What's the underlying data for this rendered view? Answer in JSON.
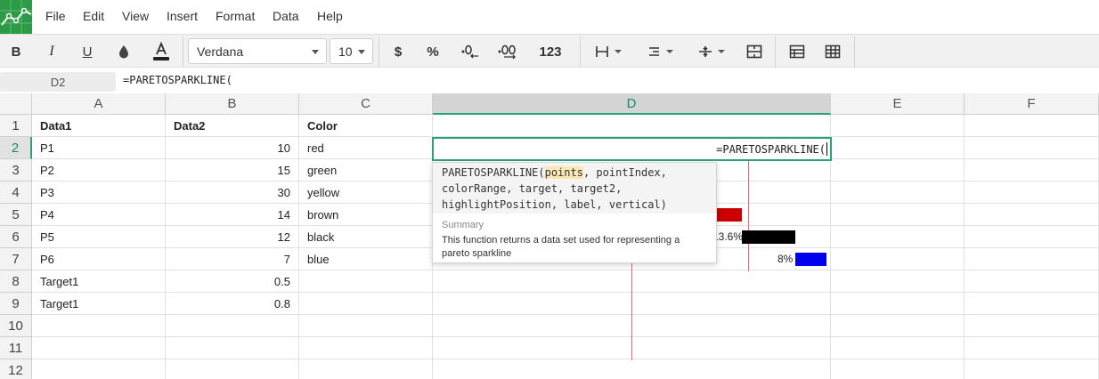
{
  "menu": {
    "items": [
      "File",
      "Edit",
      "View",
      "Insert",
      "Format",
      "Data",
      "Help"
    ]
  },
  "toolbar": {
    "bold": "B",
    "italic": "I",
    "underline": "U",
    "font_family": "Verdana",
    "font_size": "10",
    "currency": "$",
    "percent": "%",
    "decrease_decimal": ".0",
    "increase_decimal": ".00",
    "number_format": "123"
  },
  "formula_bar": {
    "cell_ref": "D2",
    "formula": "=PARETOSPARKLINE("
  },
  "columns": [
    "A",
    "B",
    "C",
    "D",
    "E",
    "F"
  ],
  "rows": [
    "1",
    "2",
    "3",
    "4",
    "5",
    "6",
    "7",
    "8",
    "9",
    "10",
    "11",
    "12"
  ],
  "cells": {
    "A": [
      "Data1",
      "P1",
      "P2",
      "P3",
      "P4",
      "P5",
      "P6",
      "Target1",
      "Target1",
      "",
      "",
      ""
    ],
    "B": [
      "Data2",
      "10",
      "15",
      "30",
      "14",
      "12",
      "7",
      "0.5",
      "0.8",
      "",
      "",
      ""
    ],
    "C": [
      "Color",
      "red",
      "green",
      "yellow",
      "brown",
      "black",
      "blue",
      "",
      "",
      "",
      "",
      ""
    ]
  },
  "sparkline": {
    "labels": [
      "13.6%",
      "8%"
    ],
    "colors": [
      "#cc0000",
      "#000000",
      "#0000ee"
    ]
  },
  "editor": {
    "text": "=PARETOSPARKLINE("
  },
  "tooltip": {
    "function_name": "PARETOSPARKLINE(",
    "first_param": "points",
    "sig_rest_line1": ", pointIndex,",
    "sig_line2": "colorRange, target, target2,",
    "sig_line3": "highlightPosition, label, vertical)",
    "summary_title": "Summary",
    "summary": "This function returns a data set used for representing a pareto sparkline"
  }
}
